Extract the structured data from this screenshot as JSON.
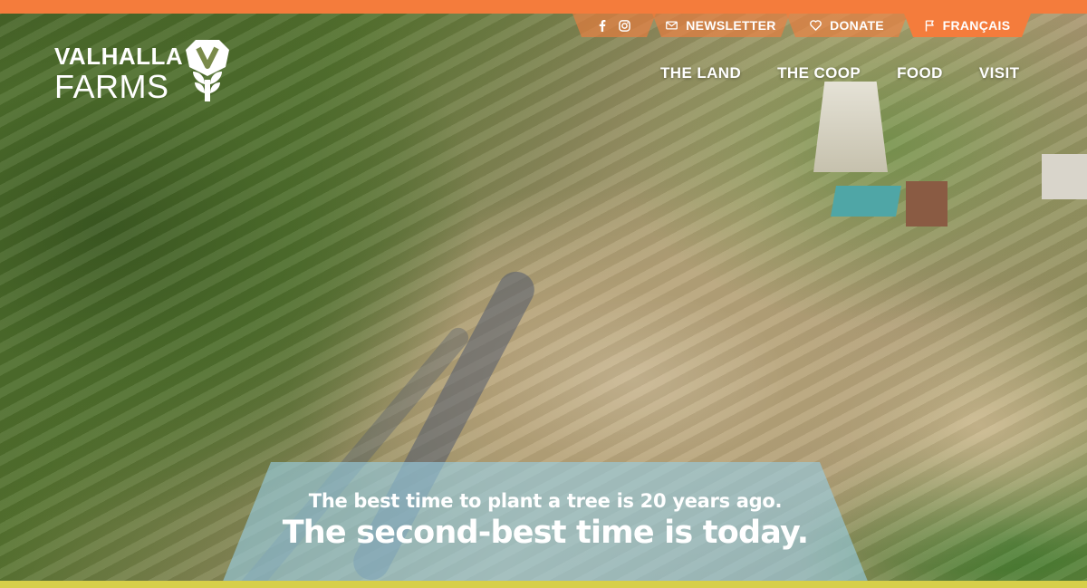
{
  "brand": {
    "name_line1": "VALHALLA",
    "name_line2": "FARMS",
    "mark_letter": "V",
    "accent_color": "#f47c3c"
  },
  "utility_nav": {
    "social_icons": [
      "facebook-icon",
      "instagram-icon"
    ],
    "newsletter_label": "NEWSLETTER",
    "donate_label": "DONATE",
    "language_label": "FRANÇAIS"
  },
  "main_nav": {
    "items": [
      {
        "label": "THE LAND"
      },
      {
        "label": "THE COOP"
      },
      {
        "label": "FOOD"
      },
      {
        "label": "VISIT"
      }
    ]
  },
  "hero": {
    "quote_line1": "The best time to plant a tree is 20 years ago.",
    "quote_line2": "The second-best time is today."
  }
}
